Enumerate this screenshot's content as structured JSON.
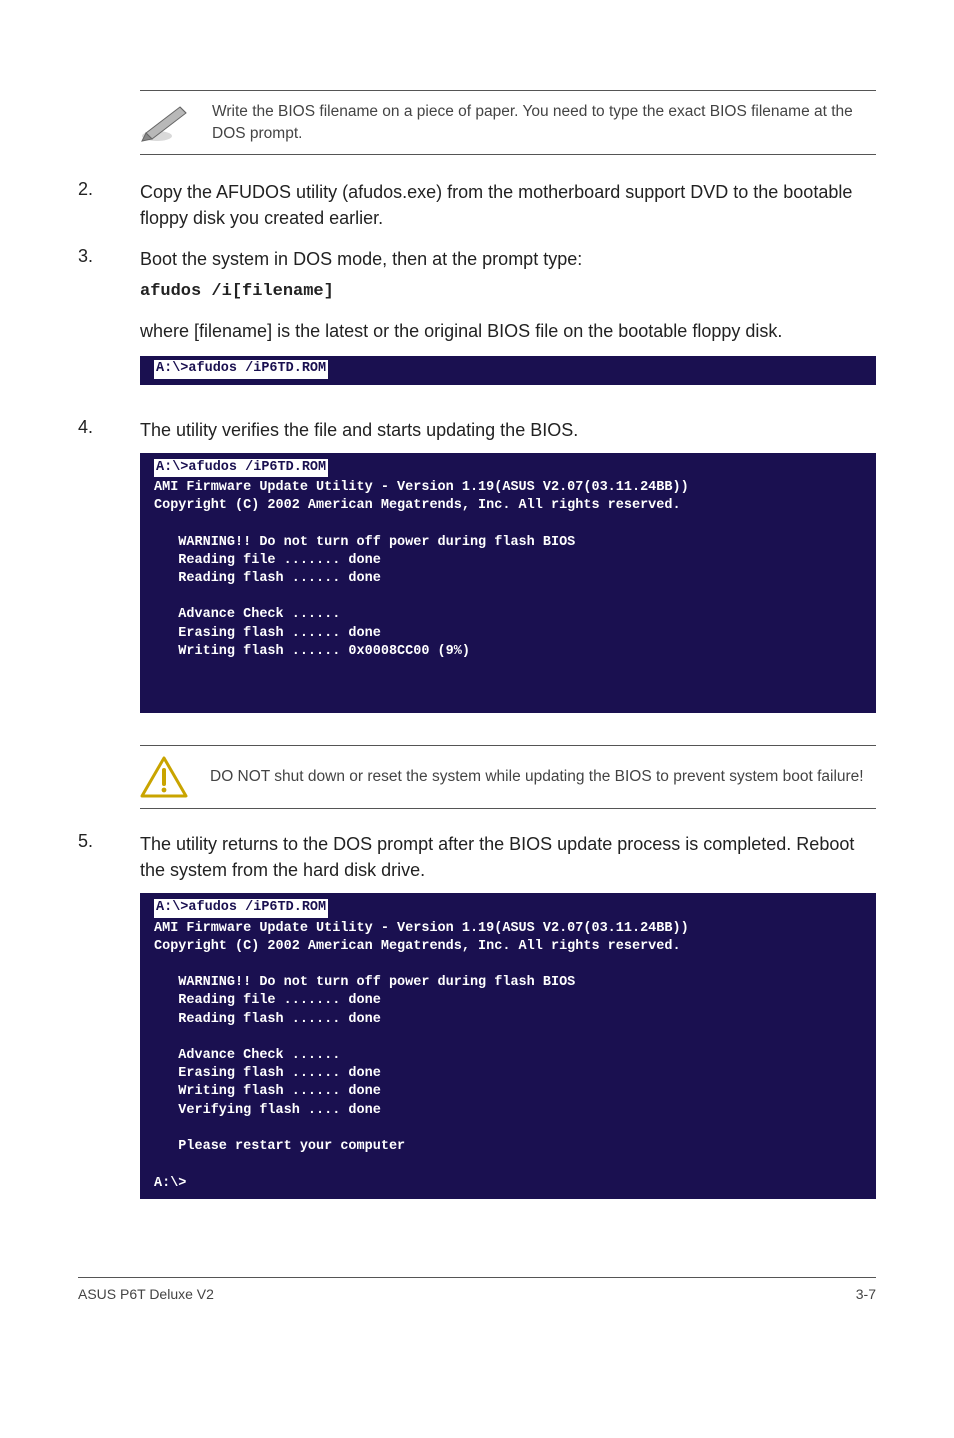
{
  "note1": {
    "text": "Write the BIOS filename on a piece of paper. You need to type the exact BIOS filename at the DOS prompt."
  },
  "steps": {
    "s2": {
      "num": "2.",
      "text": "Copy the AFUDOS utility (afudos.exe) from the motherboard support DVD to the bootable floppy disk you created earlier."
    },
    "s3": {
      "num": "3.",
      "text": "Boot the system in DOS mode, then at the prompt type:",
      "code": "afudos /i[filename]",
      "para2": "where [filename] is the latest or the original BIOS file on the bootable floppy disk."
    },
    "term1_first": "A:\\>afudos /iP6TD.ROM",
    "s4": {
      "num": "4.",
      "text": "The utility verifies the file and starts updating the BIOS."
    },
    "term2_first": "A:\\>afudos /iP6TD.ROM",
    "term2_rest": "AMI Firmware Update Utility - Version 1.19(ASUS V2.07(03.11.24BB))\nCopyright (C) 2002 American Megatrends, Inc. All rights reserved.\n\n   WARNING!! Do not turn off power during flash BIOS\n   Reading file ....... done\n   Reading flash ...... done\n\n   Advance Check ......\n   Erasing flash ...... done\n   Writing flash ...... 0x0008CC00 (9%)",
    "s5": {
      "num": "5.",
      "text": "The utility returns to the DOS prompt after the BIOS update process is completed. Reboot the system from the hard disk drive."
    },
    "term3_first": "A:\\>afudos /iP6TD.ROM",
    "term3_rest": "AMI Firmware Update Utility - Version 1.19(ASUS V2.07(03.11.24BB))\nCopyright (C) 2002 American Megatrends, Inc. All rights reserved.\n\n   WARNING!! Do not turn off power during flash BIOS\n   Reading file ....... done\n   Reading flash ...... done\n\n   Advance Check ......\n   Erasing flash ...... done\n   Writing flash ...... done\n   Verifying flash .... done\n\n   Please restart your computer\n\nA:\\>"
  },
  "warn": {
    "text": "DO NOT shut down or reset the system while updating the BIOS to prevent system boot failure!"
  },
  "footer": {
    "left": "ASUS P6T Deluxe V2",
    "right": "3-7"
  }
}
